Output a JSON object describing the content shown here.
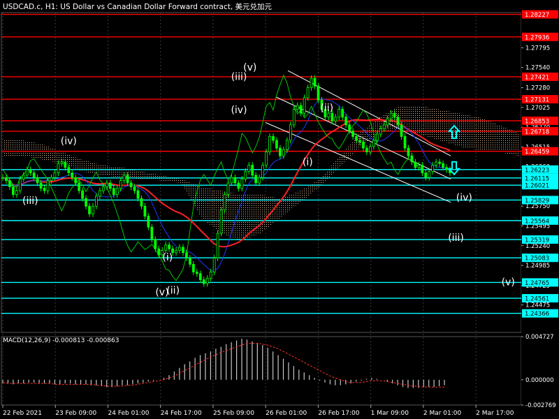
{
  "window": {
    "title": "USDCAD.c, H1:  US Dollar vs Canadian Dollar Forward contract, 美元兑加元"
  },
  "colors": {
    "background": "#000000",
    "grid": "#3a3a3a",
    "candle": "#00ff00",
    "resistance": "#ff0000",
    "support": "#00ffff",
    "channel": "#ffffff",
    "ma_slow": "#ff2020",
    "ma_fast": "#1e3cff",
    "chikou": "#00c800",
    "cloud": "#ffd8b0",
    "macd_hist": "#c8c8c8",
    "macd_signal": "#ff3030"
  },
  "chart_data": [
    {
      "type": "candlestick",
      "symbol": "USDCAD.c",
      "timeframe": "H1",
      "ylim": [
        1.2412,
        1.2825
      ],
      "price_axis_ticks": [
        "1.27795",
        "1.27540",
        "1.27280",
        "1.27025",
        "1.26770",
        "1.26515",
        "1.26260",
        "1.26005",
        "1.25750",
        "1.25495",
        "1.25240",
        "1.24985",
        "1.24725",
        "1.24475"
      ],
      "time_axis_labels": [
        "22 Feb 2021",
        "23 Feb 09:00",
        "24 Feb 01:00",
        "24 Feb 17:00",
        "25 Feb 09:00",
        "26 Feb 01:00",
        "26 Feb 17:00",
        "1 Mar 09:00",
        "2 Mar 01:00",
        "2 Mar 17:00"
      ],
      "resistance_levels": [
        {
          "value": 1.28227,
          "label": "1.28227"
        },
        {
          "value": 1.27936,
          "label": "1.27936"
        },
        {
          "value": 1.27421,
          "label": "1.27421"
        },
        {
          "value": 1.27131,
          "label": "1.27131"
        },
        {
          "value": 1.26853,
          "label": "1.26853"
        },
        {
          "value": 1.26718,
          "label": "1.26718"
        },
        {
          "value": 1.26459,
          "label": "1.26459"
        }
      ],
      "support_levels": [
        {
          "value": 1.26223,
          "label": "1.26223"
        },
        {
          "value": 1.26115,
          "label": "1.26115"
        },
        {
          "value": 1.26021,
          "label": "1.26021"
        },
        {
          "value": 1.25829,
          "label": "1.25829"
        },
        {
          "value": 1.25564,
          "label": "1.25564"
        },
        {
          "value": 1.25319,
          "label": "1.25319"
        },
        {
          "value": 1.25083,
          "label": "1.25083"
        },
        {
          "value": 1.24765,
          "label": "1.24765"
        },
        {
          "value": 1.24561,
          "label": "1.24561"
        },
        {
          "value": 1.24366,
          "label": "1.24366"
        }
      ],
      "close_series": [
        1.2612,
        1.2608,
        1.26,
        1.259,
        1.2595,
        1.261,
        1.2615,
        1.2622,
        1.2618,
        1.2612,
        1.2605,
        1.2598,
        1.2595,
        1.2608,
        1.2612,
        1.2618,
        1.263,
        1.2632,
        1.2625,
        1.2618,
        1.2612,
        1.2605,
        1.2595,
        1.2585,
        1.2575,
        1.2565,
        1.2575,
        1.2588,
        1.2595,
        1.26,
        1.2605,
        1.2598,
        1.259,
        1.2598,
        1.2608,
        1.2615,
        1.2605,
        1.26,
        1.2595,
        1.2585,
        1.2575,
        1.2562,
        1.2548,
        1.2532,
        1.252,
        1.2512,
        1.2518,
        1.2525,
        1.252,
        1.2515,
        1.2518,
        1.2522,
        1.2515,
        1.2508,
        1.25,
        1.249,
        1.2488,
        1.248,
        1.2475,
        1.2482,
        1.249,
        1.2508,
        1.254,
        1.257,
        1.259,
        1.2605,
        1.2612,
        1.2605,
        1.2598,
        1.261,
        1.262,
        1.2628,
        1.2615,
        1.2605,
        1.2612,
        1.2628,
        1.2645,
        1.2665,
        1.266,
        1.265,
        1.264,
        1.2648,
        1.266,
        1.268,
        1.27,
        1.2705,
        1.2695,
        1.2715,
        1.2728,
        1.274,
        1.273,
        1.2712,
        1.27,
        1.269,
        1.2695,
        1.2685,
        1.269,
        1.27,
        1.269,
        1.268,
        1.2672,
        1.2665,
        1.266,
        1.2658,
        1.265,
        1.2645,
        1.2652,
        1.266,
        1.2668,
        1.2675,
        1.268,
        1.2688,
        1.2695,
        1.269,
        1.268,
        1.2665,
        1.265,
        1.264,
        1.2632,
        1.2625,
        1.2628,
        1.2618,
        1.2612,
        1.262,
        1.2628,
        1.2632,
        1.263,
        1.2625,
        1.2622,
        1.2618
      ],
      "ichimoku_cloud_span_a_top": [
        1.266,
        1.266,
        1.2655,
        1.2645,
        1.2635,
        1.2628,
        1.2625,
        1.262,
        1.2615,
        1.261,
        1.26,
        1.2595,
        1.259,
        1.259,
        1.2585,
        1.2595,
        1.261,
        1.264,
        1.267,
        1.269,
        1.2705,
        1.2705,
        1.27,
        1.2695,
        1.269,
        1.268,
        1.267
      ],
      "ichimoku_cloud_span_b_bottom": [
        1.264,
        1.264,
        1.2635,
        1.263,
        1.262,
        1.2615,
        1.2612,
        1.261,
        1.2608,
        1.2605,
        1.256,
        1.254,
        1.253,
        1.254,
        1.256,
        1.258,
        1.26,
        1.2625,
        1.265,
        1.267,
        1.2675,
        1.2668,
        1.266,
        1.2652,
        1.2648,
        1.2645,
        1.264
      ],
      "elliott_wave_labels": [
        {
          "label": "(iii)",
          "price": 1.2578,
          "time_index": 10
        },
        {
          "label": "(iv)",
          "price": 1.2655,
          "time_index": 24
        },
        {
          "label": "(i)",
          "price": 1.2505,
          "time_index": 60
        },
        {
          "label": "(v)",
          "price": 1.246,
          "time_index": 58
        },
        {
          "label": "(ii)",
          "price": 1.2462,
          "time_index": 62
        },
        {
          "label": "(iii)",
          "price": 1.2738,
          "time_index": 86
        },
        {
          "label": "(v)",
          "price": 1.275,
          "time_index": 90
        },
        {
          "label": "(iv)",
          "price": 1.2695,
          "time_index": 86
        },
        {
          "label": "(ii)",
          "price": 1.2698,
          "time_index": 118
        },
        {
          "label": "(i)",
          "price": 1.2628,
          "time_index": 111
        },
        {
          "label": "(iv)",
          "price": 1.2582,
          "time_index": 168
        },
        {
          "label": "(iii)",
          "price": 1.253,
          "time_index": 165
        },
        {
          "label": "(v)",
          "price": 1.2473,
          "time_index": 184
        }
      ],
      "forecast_arrows": [
        {
          "direction": "up",
          "price": 1.267,
          "color": "#00ffff"
        },
        {
          "direction": "down",
          "price": 1.2625,
          "color": "#00ffff"
        }
      ],
      "price_labels": [
        "1.28227",
        "1.27936",
        "1.27421",
        "1.27131",
        "1.26853",
        "1.26718",
        "1.26459",
        "1.26223",
        "1.26115",
        "1.26021",
        "1.25829",
        "1.25564",
        "1.25319",
        "1.25083",
        "1.24765",
        "1.24561",
        "1.24366"
      ]
    },
    {
      "type": "bar",
      "title": "MACD(12,26,9) -0.000813 -0.000863",
      "ylim": [
        -0.002769,
        0.004727
      ],
      "y_ticks": [
        "0.004727",
        "0.000000",
        "-0.002769"
      ],
      "histogram": [
        -0.0004,
        -0.0004,
        -0.0005,
        -0.0004,
        -0.0004,
        -0.0003,
        -0.0003,
        -0.0004,
        -0.0004,
        -0.0004,
        -0.0005,
        -0.0005,
        -0.0004,
        -0.0004,
        -0.0005,
        -0.0005,
        -0.0005,
        -0.0006,
        -0.0006,
        -0.0007,
        -0.0008,
        -0.0008,
        -0.0007,
        -0.0006,
        -0.0006,
        -0.0005,
        -0.0004,
        -0.0003,
        -0.0002,
        -0.0001,
        0.0,
        0.0002,
        0.0005,
        0.0009,
        0.0013,
        0.0017,
        0.002,
        0.0024,
        0.0027,
        0.0029,
        0.0031,
        0.0034,
        0.0036,
        0.0039,
        0.0041,
        0.0043,
        0.0045,
        0.0044,
        0.0042,
        0.004,
        0.0038,
        0.0035,
        0.0031,
        0.0027,
        0.0023,
        0.0019,
        0.0015,
        0.0011,
        0.0008,
        0.0005,
        0.0002,
        -0.0001,
        -0.0003,
        -0.0005,
        -0.0006,
        -0.0006,
        -0.0005,
        -0.0004,
        -0.0002,
        -0.0001,
        0.0001,
        0.0002,
        0.0001,
        0.0,
        -0.0002,
        -0.0004,
        -0.0006,
        -0.0008,
        -0.0009,
        -0.0009,
        -0.0009,
        -0.0008,
        -0.0008,
        -0.0008,
        -0.0007,
        -0.0006
      ],
      "signal": [
        -0.0003,
        -0.0004,
        -0.0004,
        -0.0004,
        -0.0004,
        -0.0004,
        -0.0004,
        -0.0004,
        -0.0004,
        -0.0004,
        -0.0005,
        -0.0005,
        -0.0005,
        -0.0005,
        -0.0005,
        -0.0005,
        -0.0005,
        -0.0005,
        -0.0006,
        -0.0006,
        -0.0007,
        -0.0007,
        -0.0007,
        -0.0007,
        -0.0006,
        -0.0006,
        -0.0005,
        -0.0004,
        -0.0003,
        -0.0002,
        -0.0001,
        0.0,
        0.0002,
        0.0004,
        0.0007,
        0.001,
        0.0013,
        0.0016,
        0.0019,
        0.0022,
        0.0025,
        0.0027,
        0.003,
        0.0032,
        0.0034,
        0.0036,
        0.0038,
        0.004,
        0.004,
        0.004,
        0.0039,
        0.0038,
        0.0036,
        0.0034,
        0.0031,
        0.0028,
        0.0025,
        0.0022,
        0.0019,
        0.0016,
        0.0013,
        0.001,
        0.0007,
        0.0004,
        0.0002,
        0.0,
        -0.0002,
        -0.0003,
        -0.0003,
        -0.0003,
        -0.0002,
        -0.0001,
        -0.0001,
        -0.0001,
        -0.0002,
        -0.0003,
        -0.0004,
        -0.0005,
        -0.0006,
        -0.0007,
        -0.0007,
        -0.0008,
        -0.0008,
        -0.0008,
        -0.0008,
        -0.0008
      ]
    }
  ]
}
